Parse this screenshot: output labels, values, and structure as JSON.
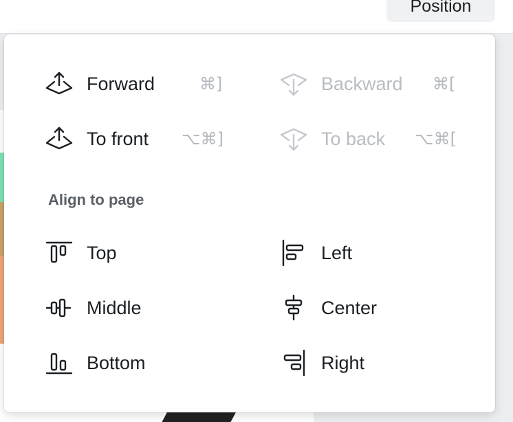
{
  "toolbar": {
    "position_button_label": "Position"
  },
  "layer": {
    "forward": {
      "label": "Forward",
      "shortcut": "⌘]",
      "icon": "bring-forward-icon",
      "enabled": true
    },
    "backward": {
      "label": "Backward",
      "shortcut": "⌘[",
      "icon": "send-backward-icon",
      "enabled": false
    },
    "to_front": {
      "label": "To front",
      "shortcut": "⌥⌘]",
      "icon": "bring-to-front-icon",
      "enabled": true
    },
    "to_back": {
      "label": "To back",
      "shortcut": "⌥⌘[",
      "icon": "send-to-back-icon",
      "enabled": false
    }
  },
  "align": {
    "title": "Align to page",
    "top": {
      "label": "Top",
      "icon": "align-top-icon"
    },
    "left": {
      "label": "Left",
      "icon": "align-left-icon"
    },
    "middle": {
      "label": "Middle",
      "icon": "align-middle-icon"
    },
    "center": {
      "label": "Center",
      "icon": "align-center-icon"
    },
    "bottom": {
      "label": "Bottom",
      "icon": "align-bottom-icon"
    },
    "right": {
      "label": "Right",
      "icon": "align-right-icon"
    }
  },
  "colors": {
    "text": "#1b1f23",
    "disabled_text": "#b9bdc2",
    "shortcut_text": "#b5b9bf",
    "section_title": "#5b6066"
  }
}
